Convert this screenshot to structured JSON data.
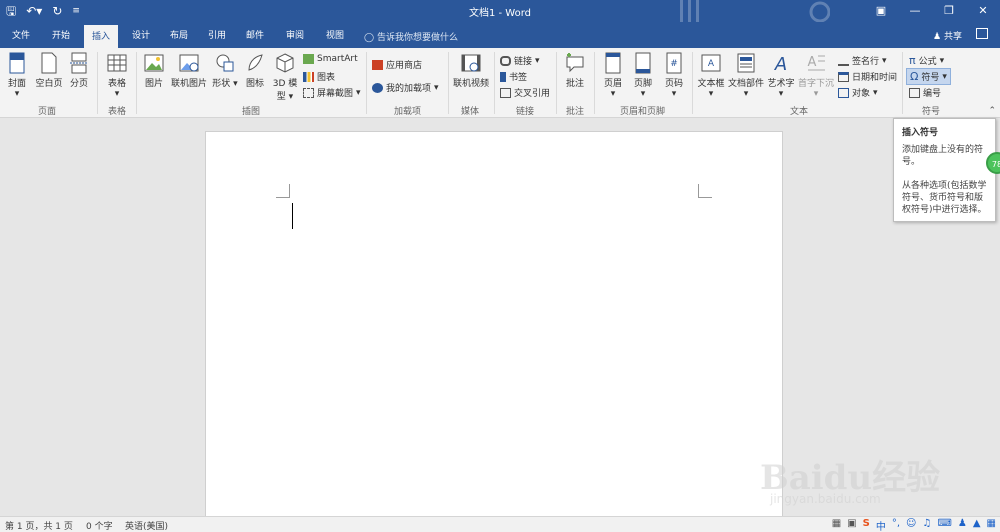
{
  "titlebar": {
    "title": "文档1 - Word",
    "qa": {
      "save_icon": "save-icon",
      "undo_icon": "undo-icon",
      "redo_icon": "redo-icon",
      "customize_icon": "customize-icon"
    },
    "controls": [
      "ribbon-display-icon",
      "minimize-icon",
      "restore-icon",
      "close-icon"
    ]
  },
  "tabs": [
    "文件",
    "开始",
    "插入",
    "设计",
    "布局",
    "引用",
    "邮件",
    "审阅",
    "视图"
  ],
  "active_tab": "插入",
  "tellme": "告诉我你想要做什么",
  "share": "共享",
  "ribbon": {
    "pages": {
      "cover": "封面",
      "blank": "空白页",
      "break": "分页",
      "group": "页面"
    },
    "tables": {
      "table": "表格",
      "group": "表格"
    },
    "illustrations": {
      "picture": "图片",
      "online_picture": "联机图片",
      "shapes": "形状",
      "icons": "图标",
      "model3d_1": "3D 模",
      "model3d_2": "型",
      "smartart": "SmartArt",
      "chart": "图表",
      "screenshot": "屏幕截图",
      "group": "插图"
    },
    "addins": {
      "store": "应用商店",
      "my_addins": "我的加载项",
      "group": "加载项"
    },
    "media": {
      "online_video": "联机视频",
      "group": "媒体"
    },
    "links": {
      "link": "链接",
      "bookmark": "书签",
      "crossref": "交叉引用",
      "group": "链接"
    },
    "comments": {
      "comment": "批注",
      "group": "批注"
    },
    "header_footer": {
      "header": "页眉",
      "footer": "页脚",
      "page_number": "页码",
      "group": "页眉和页脚"
    },
    "text": {
      "textbox": "文本框",
      "quickparts": "文档部件",
      "wordart": "艺术字",
      "dropcap": "首字下沉",
      "signature": "签名行",
      "datetime": "日期和时间",
      "object": "对象",
      "group": "文本"
    },
    "symbols": {
      "equation": "公式",
      "symbol": "符号",
      "number": "编号",
      "group": "符号"
    }
  },
  "tooltip": {
    "title": "插入符号",
    "line1": "添加键盘上没有的符号。",
    "line2": "从各种选项(包括数学符号、货币符号和版权符号)中进行选择。"
  },
  "badge": "78",
  "status": {
    "page": "第 1 页，共 1 页",
    "words": "0 个字",
    "lang": "英语(美国)"
  },
  "watermark": {
    "line1": "Baidu经验",
    "line2": "jingyan.baidu.com"
  },
  "colors": {
    "brand": "#2b579a",
    "ribbon_bg": "#f3f3f3",
    "doc_bg": "#e6e6e6"
  }
}
